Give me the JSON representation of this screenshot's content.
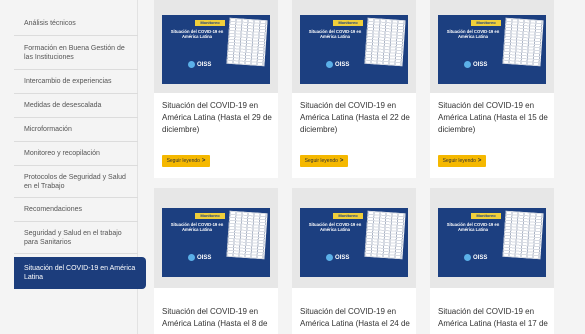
{
  "sidebar": {
    "items": [
      {
        "label": "Análisis técnicos"
      },
      {
        "label": "Formación en Buena Gestión de las Instituciones"
      },
      {
        "label": "Intercambio de experiencias"
      },
      {
        "label": "Medidas de desescalada"
      },
      {
        "label": "Microformación"
      },
      {
        "label": "Monitoreo y recopilación"
      },
      {
        "label": "Protocolos de Seguridad y Salud en el Trabajo"
      },
      {
        "label": "Recomendaciones"
      },
      {
        "label": "Seguridad y Salud en el trabajo para Sanitarios"
      },
      {
        "label": "Situación del COVID-19 en América Latina",
        "active": true
      }
    ]
  },
  "poster": {
    "tag": "Monitoreo",
    "title": "Situación del COVID-19 en América Latina",
    "logo": "OISS"
  },
  "cards": [
    {
      "title": "Situación del COVID-19 en América Latina (Hasta el 29 de diciembre)",
      "button": "Seguir leyendo"
    },
    {
      "title": "Situación del COVID-19 en América Latina (Hasta el 22 de diciembre)",
      "button": "Seguir leyendo"
    },
    {
      "title": "Situación del COVID-19 en América Latina (Hasta el 15 de diciembre)",
      "button": "Seguir leyendo"
    },
    {
      "title": "Situación del COVID-19 en América Latina (Hasta el 8 de",
      "button": ""
    },
    {
      "title": "Situación del COVID-19 en América Latina (Hasta el 24 de",
      "button": ""
    },
    {
      "title": "Situación del COVID-19 en América Latina (Hasta el 17 de",
      "button": ""
    }
  ],
  "colors": {
    "accent": "#1c3d7c",
    "button": "#f5b800",
    "tag": "#f0cf3b"
  }
}
